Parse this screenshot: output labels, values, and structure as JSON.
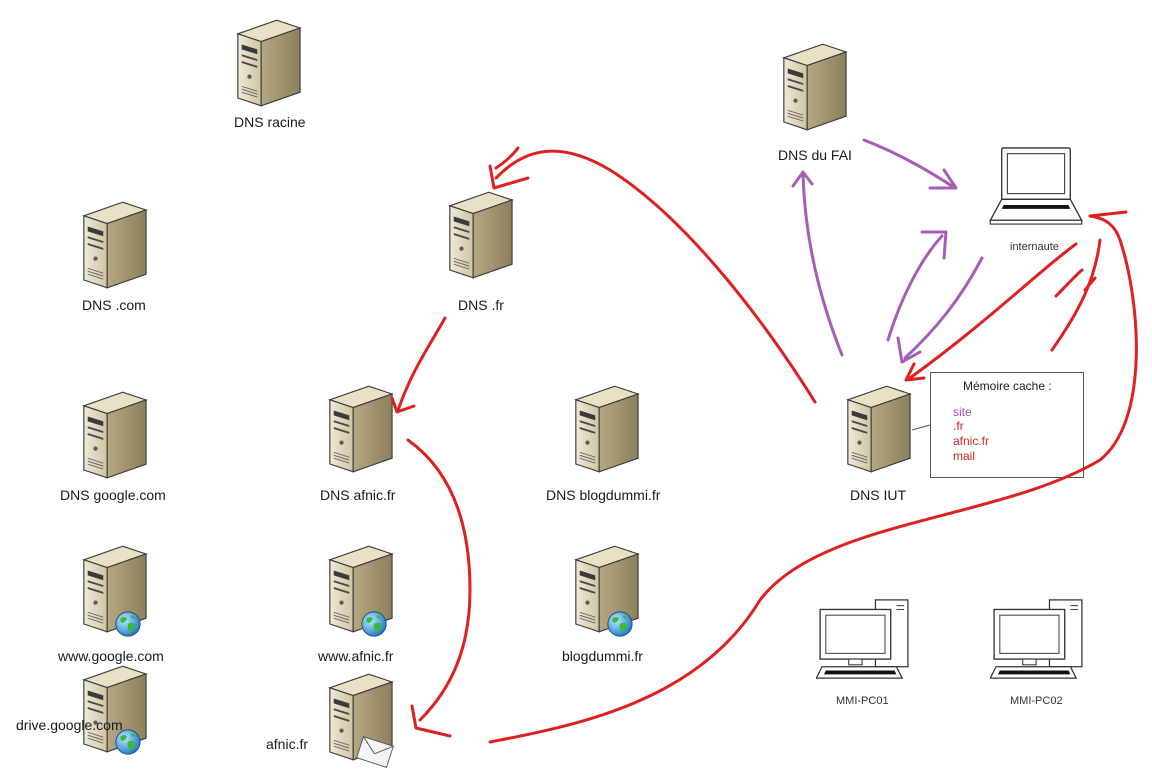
{
  "nodes": {
    "dns_racine": "DNS racine",
    "dns_com": "DNS .com",
    "dns_fr": "DNS .fr",
    "dns_fai": "DNS du FAI",
    "internaute": "internaute",
    "dns_google": "DNS google.com",
    "dns_afnic": "DNS afnic.fr",
    "dns_blogdummi": "DNS blogdummi.fr",
    "dns_iut": "DNS IUT",
    "www_google": "www.google.com",
    "www_afnic": "www.afnic.fr",
    "blogdummi": "blogdummi.fr",
    "drive_google": "drive.google.com",
    "afnic_mail": "afnic.fr",
    "mmi_pc01": "MMI-PC01",
    "mmi_pc02": "MMI-PC02"
  },
  "cache": {
    "title": "Mémoire cache :",
    "items": [
      {
        "text": "site",
        "color": "#9b4fa8"
      },
      {
        "text": ".fr",
        "color": "#d62020"
      },
      {
        "text": "afnic.fr",
        "color": "#d62020"
      },
      {
        "text": "mail",
        "color": "#d62020"
      }
    ]
  },
  "colors": {
    "red_arrow": "#e02020",
    "purple_arrow": "#a65db8"
  }
}
